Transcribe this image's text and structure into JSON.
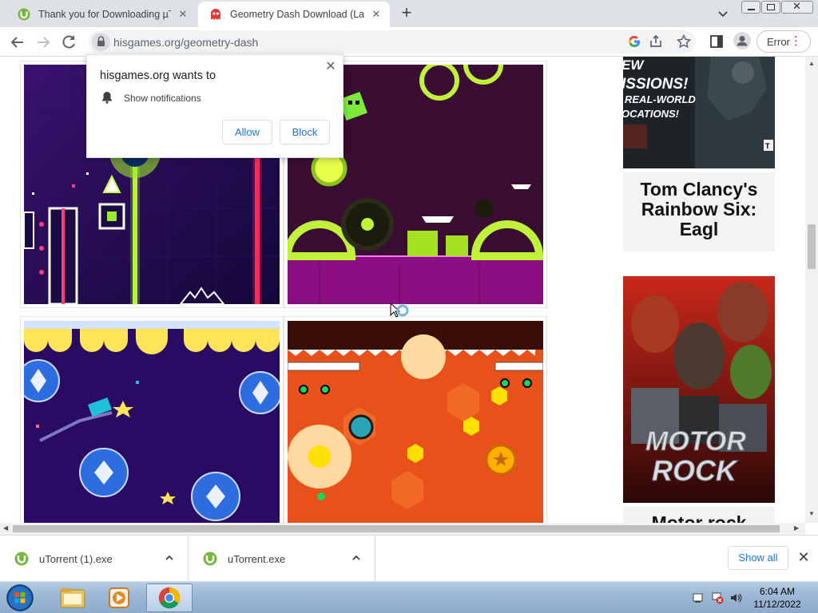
{
  "browser": {
    "tabs": [
      {
        "title": "Thank you for Downloading µTorrent",
        "active": false
      },
      {
        "title": "Geometry Dash Download (Last Version)",
        "active": true
      }
    ],
    "url": "hisgames.org/geometry-dash",
    "error_label": "Error",
    "colors": {
      "tabstrip": "#dee1e6",
      "link_blue": "#1a73e8",
      "error_red": "#c5221f"
    }
  },
  "permission_prompt": {
    "heading": "hisgames.org wants to",
    "permission": "Show notifications",
    "allow_label": "Allow",
    "block_label": "Block"
  },
  "page": {
    "sidebar_ads": [
      {
        "title": "Tom Clancy's Rainbow Six: Eagl",
        "banner_text": [
          "EW",
          "ISSIONS!",
          "REAL-WORLD",
          "OCATIONS!"
        ]
      },
      {
        "title": "Motor rock",
        "banner_text": [
          "MOTOR",
          "ROCK"
        ]
      }
    ]
  },
  "downloads": {
    "items": [
      {
        "name": "uTorrent (1).exe"
      },
      {
        "name": "uTorrent.exe"
      }
    ],
    "show_all_label": "Show all"
  },
  "taskbar": {
    "time": "6:04 AM",
    "date": "11/12/2022"
  }
}
